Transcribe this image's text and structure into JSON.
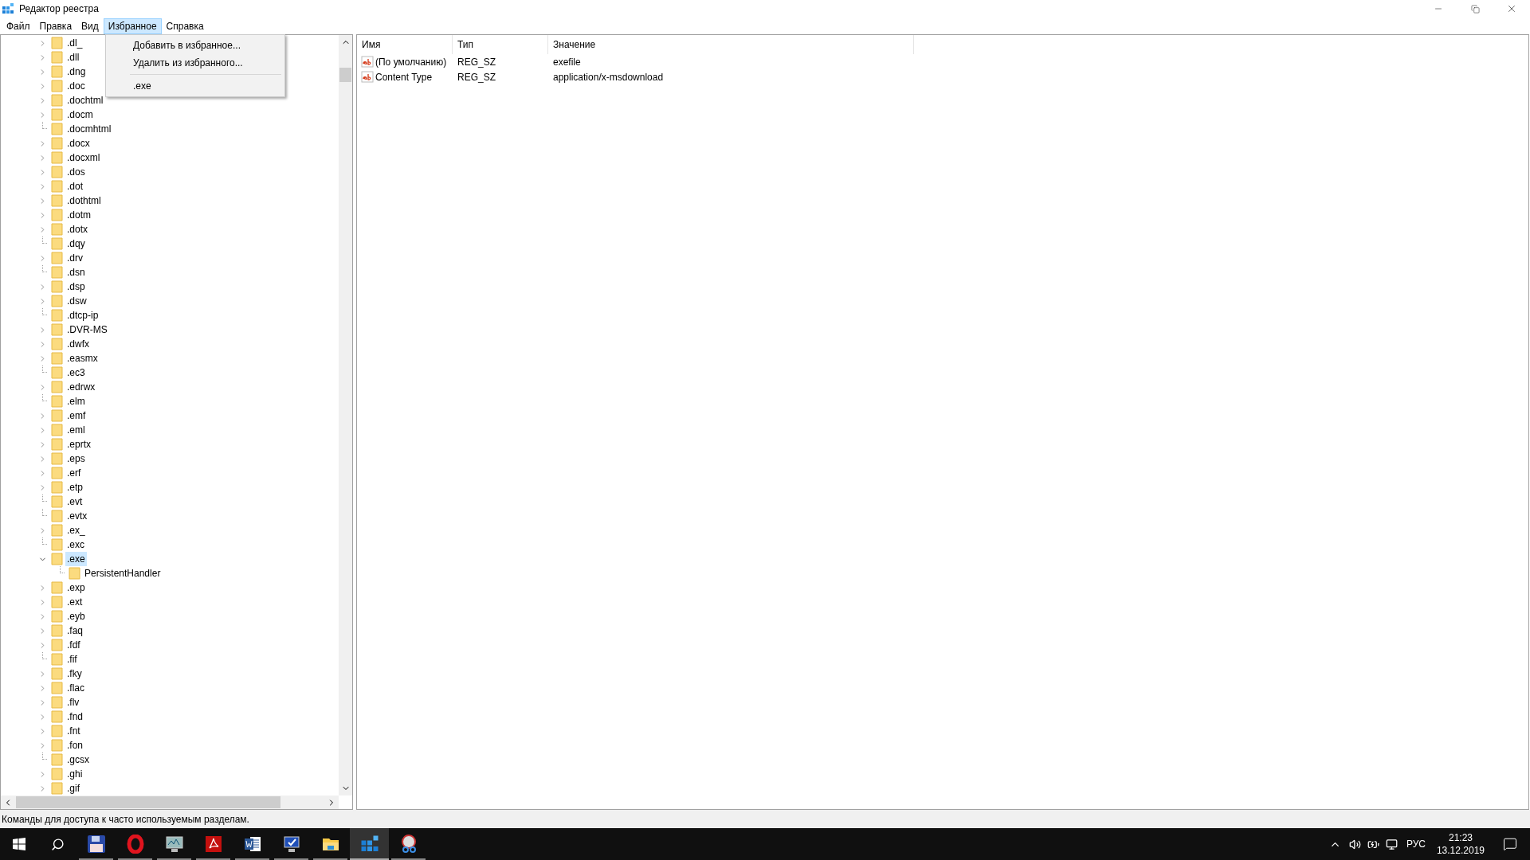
{
  "window": {
    "title": "Редактор реестра"
  },
  "menu_bar": [
    {
      "label": "Файл",
      "selected": false
    },
    {
      "label": "Правка",
      "selected": false
    },
    {
      "label": "Вид",
      "selected": false
    },
    {
      "label": "Избранное",
      "selected": true
    },
    {
      "label": "Справка",
      "selected": false
    }
  ],
  "open_menu": {
    "items": [
      {
        "kind": "command",
        "label": "Добавить в избранное..."
      },
      {
        "kind": "command",
        "label": "Удалить из избранного..."
      },
      {
        "kind": "separator"
      },
      {
        "kind": "favorite",
        "label": ".exe"
      }
    ]
  },
  "tree": [
    {
      "label": ".dl_",
      "kind": "closed",
      "selected": false
    },
    {
      "label": ".dll",
      "kind": "closed",
      "selected": false
    },
    {
      "label": ".dng",
      "kind": "closed",
      "selected": false
    },
    {
      "label": ".doc",
      "kind": "closed",
      "selected": false
    },
    {
      "label": ".dochtml",
      "kind": "closed",
      "selected": false
    },
    {
      "label": ".docm",
      "kind": "closed",
      "selected": false
    },
    {
      "label": ".docmhtml",
      "kind": "leaf",
      "selected": false
    },
    {
      "label": ".docx",
      "kind": "closed",
      "selected": false
    },
    {
      "label": ".docxml",
      "kind": "closed",
      "selected": false
    },
    {
      "label": ".dos",
      "kind": "closed",
      "selected": false
    },
    {
      "label": ".dot",
      "kind": "closed",
      "selected": false
    },
    {
      "label": ".dothtml",
      "kind": "closed",
      "selected": false
    },
    {
      "label": ".dotm",
      "kind": "closed",
      "selected": false
    },
    {
      "label": ".dotx",
      "kind": "closed",
      "selected": false
    },
    {
      "label": ".dqy",
      "kind": "leaf",
      "selected": false
    },
    {
      "label": ".drv",
      "kind": "closed",
      "selected": false
    },
    {
      "label": ".dsn",
      "kind": "leaf",
      "selected": false
    },
    {
      "label": ".dsp",
      "kind": "closed",
      "selected": false
    },
    {
      "label": ".dsw",
      "kind": "closed",
      "selected": false
    },
    {
      "label": ".dtcp-ip",
      "kind": "leaf",
      "selected": false
    },
    {
      "label": ".DVR-MS",
      "kind": "closed",
      "selected": false
    },
    {
      "label": ".dwfx",
      "kind": "closed",
      "selected": false
    },
    {
      "label": ".easmx",
      "kind": "closed",
      "selected": false
    },
    {
      "label": ".ec3",
      "kind": "leaf",
      "selected": false
    },
    {
      "label": ".edrwx",
      "kind": "closed",
      "selected": false
    },
    {
      "label": ".elm",
      "kind": "leaf",
      "selected": false
    },
    {
      "label": ".emf",
      "kind": "closed",
      "selected": false
    },
    {
      "label": ".eml",
      "kind": "closed",
      "selected": false
    },
    {
      "label": ".eprtx",
      "kind": "closed",
      "selected": false
    },
    {
      "label": ".eps",
      "kind": "closed",
      "selected": false
    },
    {
      "label": ".erf",
      "kind": "closed",
      "selected": false
    },
    {
      "label": ".etp",
      "kind": "closed",
      "selected": false
    },
    {
      "label": ".evt",
      "kind": "leaf",
      "selected": false
    },
    {
      "label": ".evtx",
      "kind": "leaf",
      "selected": false
    },
    {
      "label": ".ex_",
      "kind": "closed",
      "selected": false
    },
    {
      "label": ".exc",
      "kind": "leaf",
      "selected": false
    },
    {
      "label": ".exe",
      "kind": "open",
      "selected": true,
      "children": [
        {
          "label": "PersistentHandler",
          "kind": "leaf",
          "selected": false
        }
      ]
    },
    {
      "label": ".exp",
      "kind": "closed",
      "selected": false
    },
    {
      "label": ".ext",
      "kind": "closed",
      "selected": false
    },
    {
      "label": ".eyb",
      "kind": "closed",
      "selected": false
    },
    {
      "label": ".faq",
      "kind": "closed",
      "selected": false
    },
    {
      "label": ".fdf",
      "kind": "closed",
      "selected": false
    },
    {
      "label": ".fif",
      "kind": "leaf",
      "selected": false
    },
    {
      "label": ".fky",
      "kind": "closed",
      "selected": false
    },
    {
      "label": ".flac",
      "kind": "closed",
      "selected": false
    },
    {
      "label": ".flv",
      "kind": "closed",
      "selected": false
    },
    {
      "label": ".fnd",
      "kind": "closed",
      "selected": false
    },
    {
      "label": ".fnt",
      "kind": "closed",
      "selected": false
    },
    {
      "label": ".fon",
      "kind": "closed",
      "selected": false
    },
    {
      "label": ".gcsx",
      "kind": "leaf",
      "selected": false
    },
    {
      "label": ".ghi",
      "kind": "closed",
      "selected": false
    },
    {
      "label": ".gif",
      "kind": "closed",
      "selected": false
    }
  ],
  "values_table": {
    "columns": [
      "Имя",
      "Тип",
      "Значение"
    ],
    "rows": [
      {
        "name": "(По умолчанию)",
        "type": "REG_SZ",
        "data": "exefile"
      },
      {
        "name": "Content Type",
        "type": "REG_SZ",
        "data": "application/x-msdownload"
      }
    ]
  },
  "status_bar": "Команды для доступа к часто используемым разделам.",
  "taskbar": {
    "apps": [
      {
        "kind": "floppy",
        "running": true,
        "selected": false
      },
      {
        "kind": "opera",
        "running": true,
        "selected": false
      },
      {
        "kind": "monitor",
        "running": true,
        "selected": false
      },
      {
        "kind": "pdf",
        "running": true,
        "selected": false
      },
      {
        "kind": "word",
        "running": true,
        "selected": false
      },
      {
        "kind": "monitor-check",
        "running": true,
        "selected": false
      },
      {
        "kind": "folder",
        "running": true,
        "selected": false
      },
      {
        "kind": "registry",
        "running": true,
        "selected": true
      },
      {
        "kind": "snip",
        "running": true,
        "selected": false
      }
    ],
    "tray": {
      "language": "РУС",
      "time": "21:23",
      "date": "13.12.2019"
    }
  }
}
